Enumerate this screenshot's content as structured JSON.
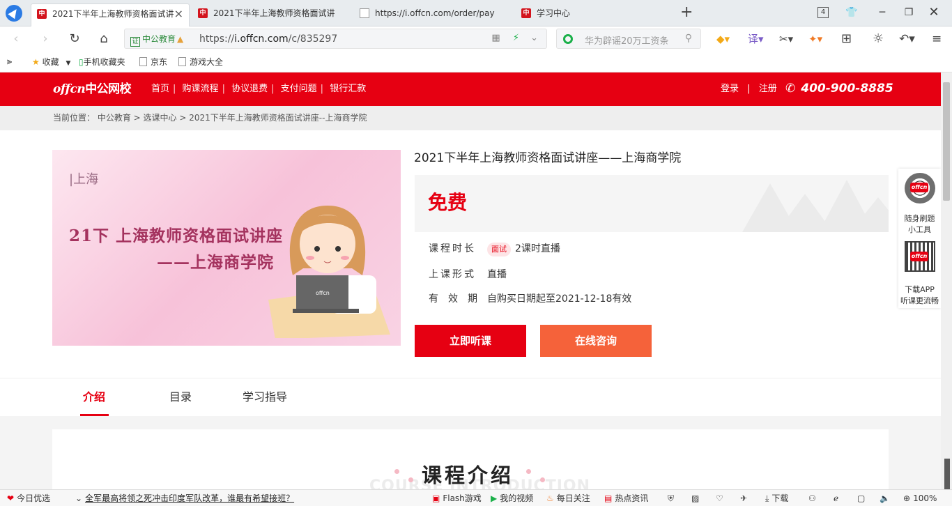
{
  "browser": {
    "tabs": [
      {
        "title": "2021下半年上海教师资格面试讲",
        "active": true,
        "icon": "offcn-favicon"
      },
      {
        "title": "2021下半年上海教师资格面试讲",
        "active": false,
        "icon": "offcn-favicon"
      },
      {
        "title": "https://i.offcn.com/order/pay",
        "active": false,
        "icon": "page-icon"
      },
      {
        "title": "学习中心",
        "active": false,
        "icon": "offcn-favicon"
      }
    ],
    "tab_count": "4",
    "address": {
      "cert_label": "中公教育",
      "url_prefix": "https://",
      "url_host": "i.offcn.com",
      "url_path": "/c/835297"
    },
    "search": {
      "placeholder": "华为辟谣20万工资条"
    },
    "bookmarks": [
      "收藏",
      "手机收藏夹",
      "京东",
      "游戏大全"
    ]
  },
  "site": {
    "logo_text_a": "offcn",
    "logo_text_b": "中公网校",
    "nav": [
      "首页",
      "购课流程",
      "协议退费",
      "支付问题",
      "银行汇款"
    ],
    "login": "登录",
    "register": "注册",
    "phone": "400-900-8885",
    "brand_color": "#e60012"
  },
  "breadcrumb": {
    "label": "当前位置：",
    "items": [
      "中公教育",
      "选课中心",
      "2021下半年上海教师资格面试讲座--上海商学院"
    ]
  },
  "course": {
    "banner": {
      "city": "上海",
      "line1": "21下 上海教师资格面试讲座",
      "line2": "——上海商学院"
    },
    "title": "2021下半年上海教师资格面试讲座——上海商学院",
    "price": "免费",
    "duration_label": "课程时长",
    "duration_tag": "面试",
    "duration_value": "2课时直播",
    "format_label": "上课形式",
    "format_value": "直播",
    "validity_label": "有效期",
    "validity_value": "自购买日期起至2021-12-18有效",
    "btn_listen": "立即听课",
    "btn_consult": "在线咨询"
  },
  "side_widget": {
    "tool_line1": "随身刷题",
    "tool_line2": "小工具",
    "app_line1": "下载APP",
    "app_line2": "听课更流畅"
  },
  "content_tabs": [
    "介绍",
    "目录",
    "学习指导"
  ],
  "intro": {
    "title": "课程介绍",
    "bg_text": "COURSE INTRODUCTION"
  },
  "statusbar": {
    "today": "今日优选",
    "news": "全军最高将领之死冲击印度军队改革，谁最有希望接班？",
    "flash": "Flash游戏",
    "video": "我的视频",
    "follow": "每日关注",
    "hot": "热点资讯",
    "download": "下载",
    "zoom": "100%"
  }
}
